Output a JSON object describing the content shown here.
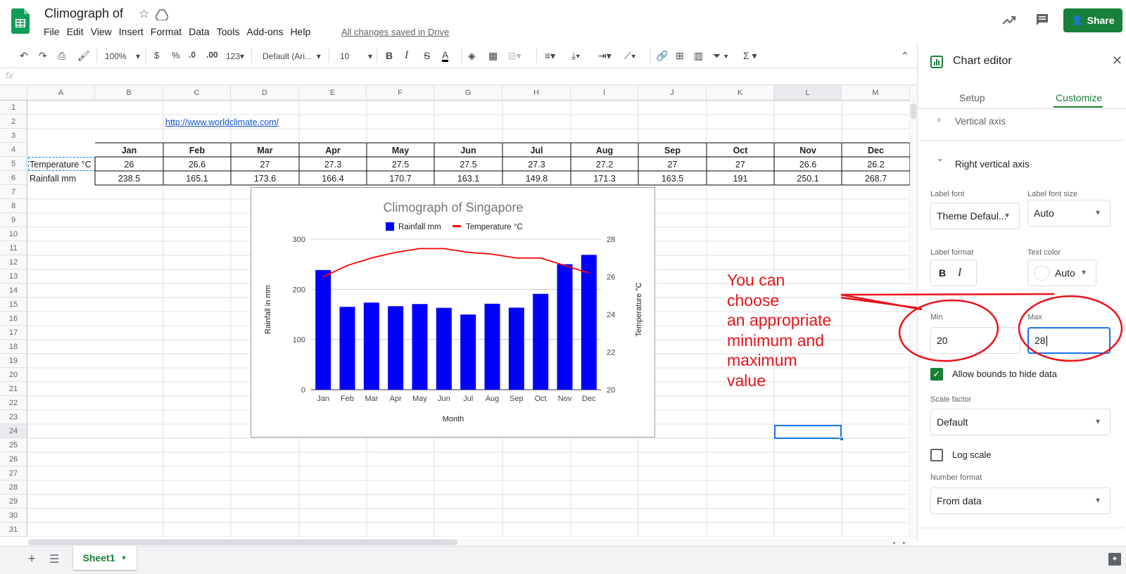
{
  "header": {
    "title": "Climograph of",
    "menus": [
      "File",
      "Edit",
      "View",
      "Insert",
      "Format",
      "Data",
      "Tools",
      "Add-ons",
      "Help"
    ],
    "saved_status": "All changes saved in Drive",
    "share_label": "Share"
  },
  "toolbar": {
    "zoom": "100%",
    "currency": "$",
    "percent": "%",
    "dec_less": ".0",
    "dec_more": ".00",
    "number_format": "123",
    "font": "Default (Ari...",
    "font_size": "10",
    "bold": "B",
    "italic": "I",
    "strike": "S",
    "text_color": "A"
  },
  "formula_bar": {
    "label": "fx"
  },
  "grid": {
    "columns": [
      "A",
      "B",
      "C",
      "D",
      "E",
      "F",
      "G",
      "H",
      "I",
      "J",
      "K",
      "L",
      "M"
    ],
    "rows": [
      "1",
      "2",
      "3",
      "4",
      "5",
      "6",
      "7",
      "8",
      "9",
      "10",
      "11",
      "12",
      "13",
      "14",
      "15",
      "16",
      "17",
      "18",
      "19",
      "20",
      "21",
      "22",
      "23",
      "24",
      "25",
      "26",
      "27",
      "28",
      "29",
      "30",
      "31"
    ],
    "link": "http://www.worldclimate.com/",
    "months": [
      "Jan",
      "Feb",
      "Mar",
      "Apr",
      "May",
      "Jun",
      "Jul",
      "Aug",
      "Sep",
      "Oct",
      "Nov",
      "Dec"
    ],
    "temp_label": "Temperature °C",
    "temp_values": [
      "26",
      "26.6",
      "27",
      "27.3",
      "27.5",
      "27.5",
      "27.3",
      "27.2",
      "27",
      "27",
      "26.6",
      "26.2"
    ],
    "rain_label": "Rainfall mm",
    "rain_values": [
      "238.5",
      "165.1",
      "173.6",
      "166.4",
      "170.7",
      "163.1",
      "149.8",
      "171.3",
      "163.5",
      "191",
      "250.1",
      "268.7"
    ]
  },
  "chart_data": {
    "type": "bar",
    "title": "Climograph of Singapore",
    "categories": [
      "Jan",
      "Feb",
      "Mar",
      "Apr",
      "May",
      "Jun",
      "Jul",
      "Aug",
      "Sep",
      "Oct",
      "Nov",
      "Dec"
    ],
    "series": [
      {
        "name": "Rainfall mm",
        "type": "bar",
        "axis": "left",
        "color": "#0000ff",
        "values": [
          238.5,
          165.1,
          173.6,
          166.4,
          170.7,
          163.1,
          149.8,
          171.3,
          163.5,
          191,
          250.1,
          268.7
        ]
      },
      {
        "name": "Temperature °C",
        "type": "line",
        "axis": "right",
        "color": "#ff0000",
        "values": [
          26,
          26.6,
          27,
          27.3,
          27.5,
          27.5,
          27.3,
          27.2,
          27,
          27,
          26.6,
          26.2
        ]
      }
    ],
    "xlabel": "Month",
    "ylabel": "Rainfall in mm",
    "y2label": "Temperature °C",
    "ylim": [
      0,
      300
    ],
    "y2lim": [
      20,
      28
    ],
    "yticks": [
      "0",
      "100",
      "200",
      "300"
    ],
    "y2ticks": [
      "20",
      "22",
      "24",
      "26",
      "28"
    ],
    "legend_position": "top",
    "grid": true
  },
  "sidebar": {
    "title": "Chart editor",
    "tab_setup": "Setup",
    "tab_customize": "Customize",
    "section_vertical": "Vertical axis",
    "section_right": "Right vertical axis",
    "label_font": "Label font",
    "label_font_value": "Theme Defaul...",
    "label_font_size": "Label font size",
    "label_font_size_value": "Auto",
    "label_format": "Label format",
    "bold_btn": "B",
    "italic_btn": "I",
    "text_color": "Text color",
    "text_color_value": "Auto",
    "min_label": "Min",
    "min_value": "20",
    "max_label": "Max",
    "max_value": "28",
    "allow_bounds": "Allow bounds to hide data",
    "scale_factor": "Scale factor",
    "scale_factor_value": "Default",
    "log_scale": "Log scale",
    "number_format": "Number format",
    "number_format_value": "From data"
  },
  "annotation": {
    "lines": [
      "You can",
      "choose",
      "an appropriate",
      "minimum and",
      "maximum",
      "value"
    ],
    "color": "#e8121a"
  },
  "bottom": {
    "sheet_name": "Sheet1"
  }
}
